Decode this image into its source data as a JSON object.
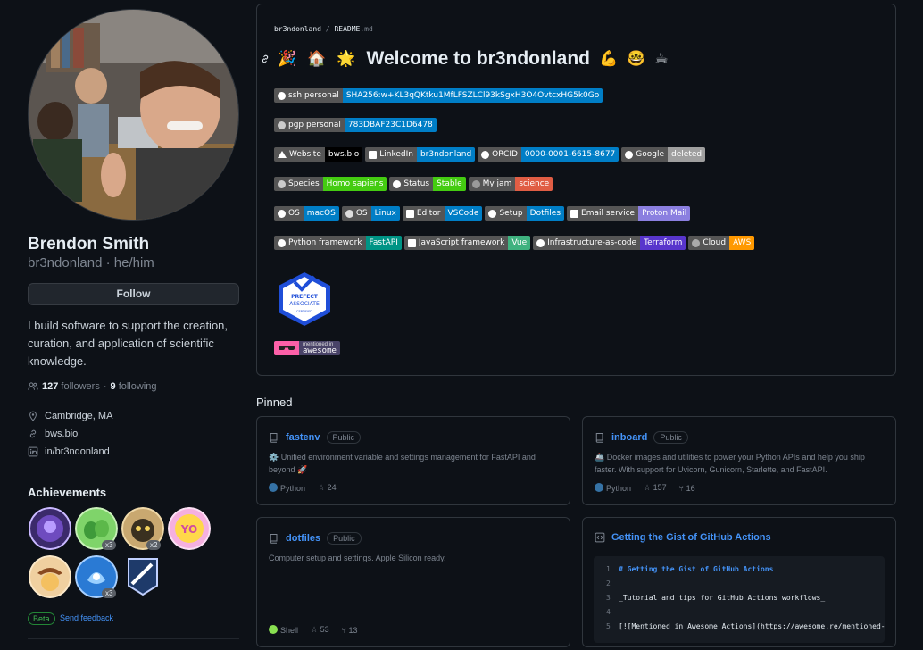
{
  "profile": {
    "name": "Brendon Smith",
    "handle": "br3ndonland",
    "pronouns": "he/him",
    "follow_label": "Follow",
    "bio": "I build software to support the creation, curation, and application of scientific knowledge.",
    "followers": "127",
    "followers_label": "followers",
    "following": "9",
    "following_label": "following",
    "location": "Cambridge, MA",
    "website": "bws.bio",
    "linkedin": "in/br3ndonland"
  },
  "achievements": {
    "title": "Achievements",
    "counts": [
      "x3",
      "x2",
      "x3"
    ],
    "beta_label": "Beta",
    "feedback_label": "Send feedback"
  },
  "readme": {
    "owner": "br3ndonland",
    "file": "README",
    "ext": ".md",
    "heading": "Welcome to br3ndonland",
    "emojis_before": [
      "🎉",
      "🏠",
      "🌟"
    ],
    "emojis_after": [
      "💪",
      "🤓",
      "☕"
    ],
    "badges": {
      "ssh": {
        "label": "ssh personal",
        "value": "SHA256:w+KL3qQKtku1MfLFSZLCl93kSgxH3O4OvtcxHG5k0Go",
        "color": "#007ec6"
      },
      "pgp": {
        "label": "pgp personal",
        "value": "783DBAF23C1D6478",
        "color": "#007ec6"
      },
      "website": {
        "label": "Website",
        "value": "bws.bio",
        "color": "#000000"
      },
      "linkedin": {
        "label": "LinkedIn",
        "value": "br3ndonland",
        "color": "#007ec6"
      },
      "orcid": {
        "label": "ORCID",
        "value": "0000-0001-6615-8677",
        "color": "#007ec6"
      },
      "google": {
        "label": "Google",
        "value": "deleted",
        "color": "#9f9f9f"
      },
      "species": {
        "label": "Species",
        "value": "Homo sapiens",
        "color": "#4c1"
      },
      "status": {
        "label": "Status",
        "value": "Stable",
        "color": "#4c1"
      },
      "jam": {
        "label": "My jam",
        "value": "science",
        "color": "#e05d44"
      },
      "os1": {
        "label": "OS",
        "value": "macOS",
        "color": "#007ec6"
      },
      "os2": {
        "label": "OS",
        "value": "Linux",
        "color": "#007ec6"
      },
      "editor": {
        "label": "Editor",
        "value": "VSCode",
        "color": "#007ec6"
      },
      "setup": {
        "label": "Setup",
        "value": "Dotfiles",
        "color": "#007ec6"
      },
      "email": {
        "label": "Email service",
        "value": "Proton Mail",
        "color": "#8b7fe0"
      },
      "python": {
        "label": "Python framework",
        "value": "FastAPI",
        "color": "#009485"
      },
      "js": {
        "label": "JavaScript framework",
        "value": "Vue",
        "color": "#3fb27f"
      },
      "iac": {
        "label": "Infrastructure-as-code",
        "value": "Terraform",
        "color": "#5835cc"
      },
      "cloud": {
        "label": "Cloud",
        "value": "AWS",
        "color": "#f90"
      }
    },
    "cert": {
      "line1": "PREFECT",
      "line2": "ASSOCIATE",
      "line3": "CERTIFIED"
    },
    "awesome": {
      "small": "mentioned in",
      "big": "awesome"
    }
  },
  "pinned": {
    "title": "Pinned",
    "visibility": "Public",
    "repos": [
      {
        "name": "fastenv",
        "desc": "Unified environment variable and settings management for FastAPI and beyond 🚀",
        "lang": "Python",
        "lang_color": "#3572A5",
        "stars": "24",
        "forks": ""
      },
      {
        "name": "inboard",
        "desc": "🚢 Docker images and utilities to power your Python APIs and help you ship faster. With support for Uvicorn, Gunicorn, Starlette, and FastAPI.",
        "lang": "Python",
        "lang_color": "#3572A5",
        "stars": "157",
        "forks": "16"
      },
      {
        "name": "dotfiles",
        "desc": "Computer setup and settings. Apple Silicon ready.",
        "lang": "Shell",
        "lang_color": "#89e051",
        "stars": "53",
        "forks": "13"
      }
    ],
    "gist": {
      "title": "Getting the Gist of GitHub Actions",
      "lines": [
        {
          "n": "1",
          "text": "# Getting the Gist of GitHub Actions"
        },
        {
          "n": "2",
          "text": ""
        },
        {
          "n": "3",
          "text": "_Tutorial and tips for GitHub Actions workflows_"
        },
        {
          "n": "4",
          "text": ""
        },
        {
          "n": "5",
          "text": "[![Mentioned in Awesome Actions](https://awesome.re/mentioned-badge.svg)]"
        }
      ]
    }
  }
}
